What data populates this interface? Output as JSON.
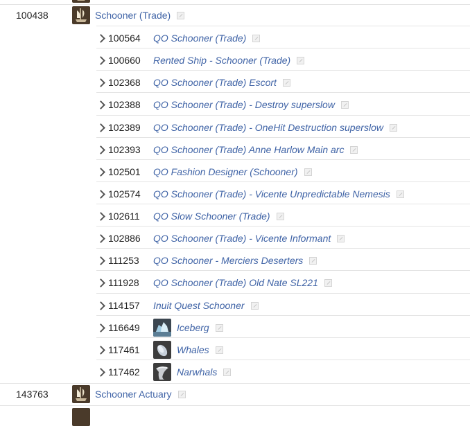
{
  "parents": [
    {
      "id": "100438",
      "label": "Schooner (Trade)",
      "icon": "ship-icon"
    },
    {
      "id": "143763",
      "label": "Schooner Actuary",
      "icon": "ship-icon"
    }
  ],
  "children": [
    {
      "id": "100564",
      "label": "QO Schooner (Trade)"
    },
    {
      "id": "100660",
      "label": "Rented Ship - Schooner (Trade)"
    },
    {
      "id": "102368",
      "label": "QO Schooner (Trade) Escort"
    },
    {
      "id": "102388",
      "label": "QO Schooner (Trade) - Destroy superslow"
    },
    {
      "id": "102389",
      "label": "QO Schooner (Trade) - OneHit Destruction superslow"
    },
    {
      "id": "102393",
      "label": "QO Schooner (Trade) Anne Harlow Main arc"
    },
    {
      "id": "102501",
      "label": "QO Fashion Designer (Schooner)"
    },
    {
      "id": "102574",
      "label": "QO Schooner (Trade) - Vicente Unpredictable Nemesis"
    },
    {
      "id": "102611",
      "label": "QO Slow Schooner (Trade)"
    },
    {
      "id": "102886",
      "label": "QO Schooner (Trade) - Vicente Informant"
    },
    {
      "id": "111253",
      "label": "QO Schooner - Merciers Deserters"
    },
    {
      "id": "111928",
      "label": "QO Schooner (Trade) Old Nate SL221"
    },
    {
      "id": "114157",
      "label": "Inuit Quest Schooner"
    },
    {
      "id": "116649",
      "label": "Iceberg",
      "icon": "iceberg-icon"
    },
    {
      "id": "117461",
      "label": "Whales",
      "icon": "whale-icon"
    },
    {
      "id": "117462",
      "label": "Narwhals",
      "icon": "narwhal-icon"
    }
  ]
}
